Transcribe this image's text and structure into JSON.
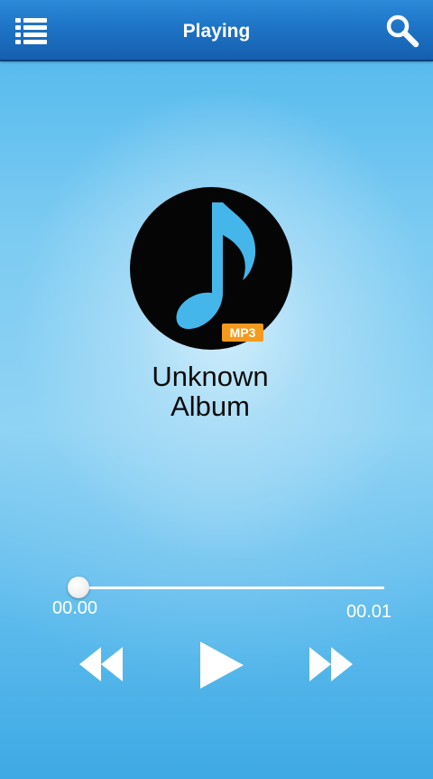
{
  "header": {
    "title": "Playing",
    "menu_icon": "list-menu-icon",
    "search_icon": "search-icon"
  },
  "now_playing": {
    "album_title_line1": "Unknown",
    "album_title_line2": "Album",
    "badge": "MP3",
    "art_icon": "music-note-icon"
  },
  "progress": {
    "elapsed": "00.00",
    "total": "00.01",
    "fraction": 0
  },
  "controls": {
    "previous_icon": "rewind-icon",
    "play_icon": "play-icon",
    "next_icon": "fast-forward-icon"
  },
  "colors": {
    "header_blue": "#1e74c6",
    "background_blue": "#7ccbf2",
    "note_blue": "#45b6ea",
    "badge_orange": "#f39a1f"
  }
}
